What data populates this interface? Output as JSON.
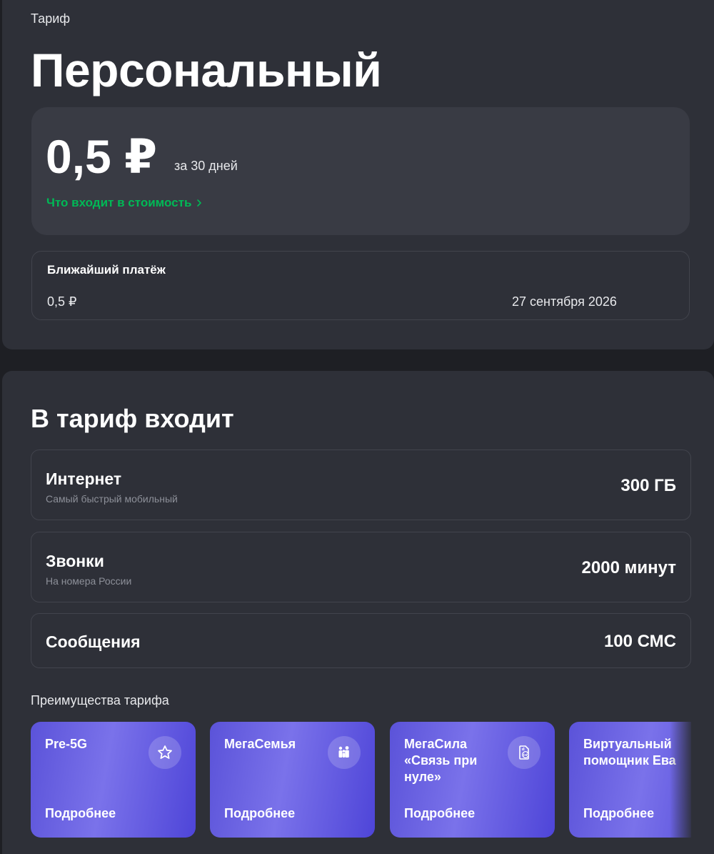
{
  "tariff": {
    "eyebrow": "Тариф",
    "name": "Персональный",
    "price": "0,5 ₽",
    "period": "за 30 дней",
    "details_link": "Что входит в стоимость"
  },
  "payment": {
    "title": "Ближайший платёж",
    "amount": "0,5 ₽",
    "date": "27 сентября 2026"
  },
  "included": {
    "title": "В тариф входит",
    "items": [
      {
        "name": "Интернет",
        "subtitle": "Самый быстрый мобильный",
        "value": "300 ГБ"
      },
      {
        "name": "Звонки",
        "subtitle": "На номера России",
        "value": "2000 минут"
      },
      {
        "name": "Сообщения",
        "subtitle": "",
        "value": "100 СМС"
      }
    ]
  },
  "benefits": {
    "label": "Преимущества тарифа",
    "cards": [
      {
        "name": "Pre-5G",
        "more": "Подробнее",
        "icon": "star-icon"
      },
      {
        "name": "МегаСемья",
        "more": "Подробнее",
        "icon": "family-icon"
      },
      {
        "name": "МегаСила «Связь при нуле»",
        "more": "Подробнее",
        "icon": "sim-zero-icon"
      },
      {
        "name": "Виртуальный помощник Ева",
        "more": "Подробнее",
        "icon": ""
      }
    ]
  },
  "colors": {
    "accent_green": "#00b956",
    "card_purple": "#5b53d9",
    "panel_bg": "#2e3038"
  }
}
